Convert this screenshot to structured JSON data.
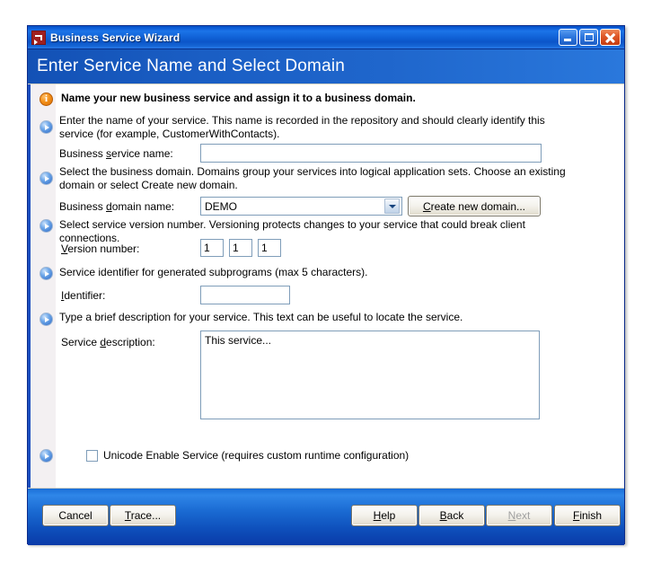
{
  "window": {
    "title": "Business Service Wizard",
    "app_icon": "wizard-icon",
    "minimize_label": "Minimize",
    "maximize_label": "Maximize",
    "close_label": "Close"
  },
  "banner": {
    "title": "Enter Service Name and Select Domain"
  },
  "content": {
    "headline": "Name your new business service and assign it to a business domain.",
    "service_name": {
      "description": "Enter the name of your service. This name is recorded in the repository and should clearly identify this service (for example, CustomerWithContacts).",
      "label_pre": "Business ",
      "label_accel": "s",
      "label_post": "ervice name:",
      "value": "",
      "placeholder": ""
    },
    "domain": {
      "description": "Select the business domain. Domains group your services into logical application sets. Choose  an existing domain or select Create new domain.",
      "label_pre": "Business ",
      "label_accel": "d",
      "label_post": "omain name:",
      "selected": "DEMO",
      "options": [
        "DEMO"
      ],
      "create_button_accel": "C",
      "create_button_post": "reate new domain..."
    },
    "version": {
      "description": "Select service version number. Versioning protects changes to your service that could break client connections.",
      "label_accel": "V",
      "label_post": "ersion number:",
      "major": "1",
      "minor": "1",
      "patch": "1"
    },
    "identifier": {
      "description_pre": "S",
      "description_accel": "",
      "description": "Service identifier for generated subprograms (max 5 characters).",
      "label_accel": "I",
      "label_post": "dentifier:",
      "value": ""
    },
    "service_description": {
      "description": "Type a brief description for your service. This text can be useful to locate the service.",
      "label_pre": "Service ",
      "label_accel": "d",
      "label_post": "escription:",
      "value": "This service..."
    },
    "unicode": {
      "checked": false,
      "label": "Unicode Enable Service (requires custom runtime configuration)"
    }
  },
  "footer": {
    "cancel": "Cancel",
    "trace_accel": "T",
    "trace_post": "race...",
    "help_accel": "H",
    "help_post": "elp",
    "back_accel": "B",
    "back_post": "ack",
    "next_accel": "N",
    "next_post": "ext",
    "next_enabled": false,
    "finish_accel": "F",
    "finish_post": "inish"
  },
  "colors": {
    "title_bar_blue": "#1163d8",
    "banner_blue": "#1f66cc",
    "accent_border": "#1c4fc0",
    "info_orange": "#f39019",
    "bullet_blue": "#2a66c4",
    "field_border": "#7f9db9",
    "disabled_text": "#a0a0a0"
  }
}
